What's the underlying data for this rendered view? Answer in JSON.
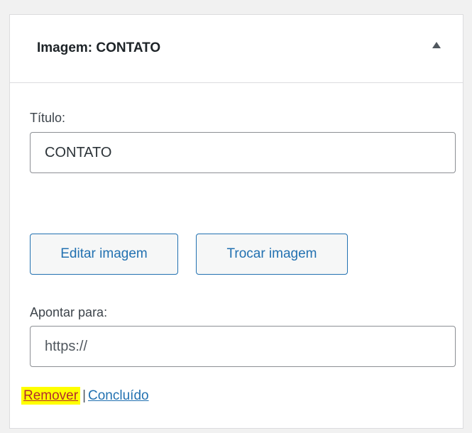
{
  "widget": {
    "title": "Imagem: CONTATO"
  },
  "form": {
    "title_label": "Título:",
    "title_value": "CONTATO",
    "link_label": "Apontar para:",
    "link_value": "",
    "link_placeholder": "https://"
  },
  "buttons": {
    "edit_label": "Editar imagem",
    "replace_label": "Trocar imagem"
  },
  "actions": {
    "remove_label": "Remover",
    "separator": "|",
    "done_label": "Concluído"
  },
  "colors": {
    "accent": "#2271b1",
    "remove": "#b32d2e",
    "highlight": "#ffff00"
  },
  "icons": {
    "toggle": "triangle-up-icon"
  }
}
